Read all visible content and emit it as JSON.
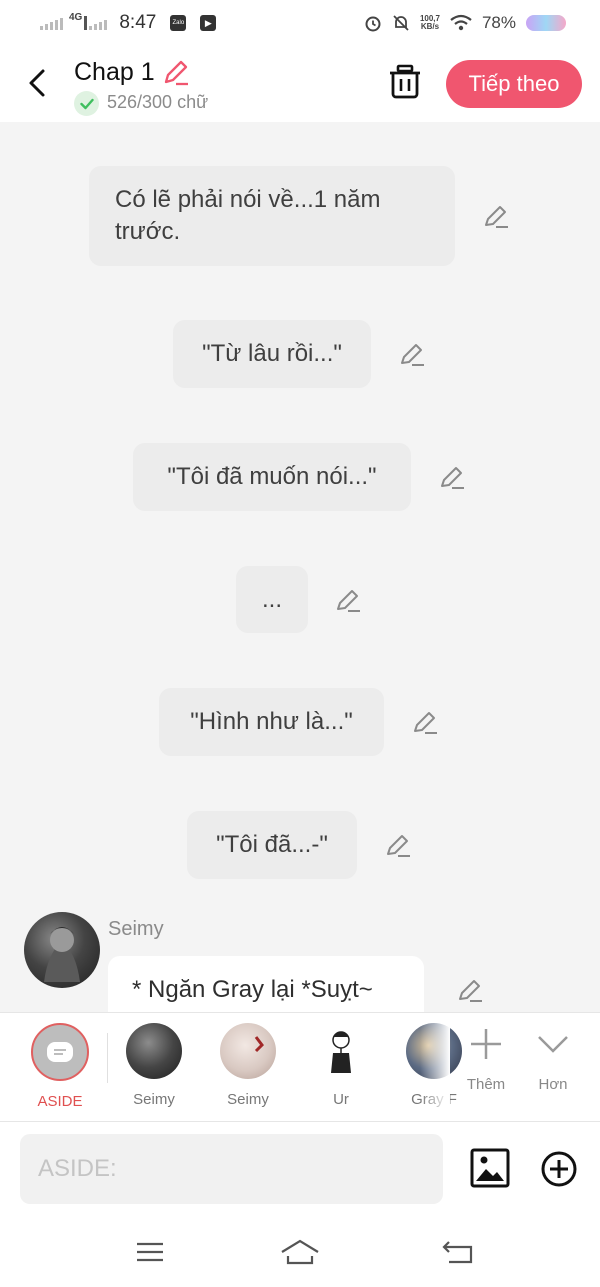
{
  "status_bar": {
    "network": "4G",
    "time": "8:47",
    "apps": [
      "Zalo",
      "▶"
    ],
    "speed_value": "100,7",
    "speed_unit": "KB/s",
    "battery_pct": "78%"
  },
  "header": {
    "title": "Chap 1",
    "word_count": "526/300 chữ",
    "next_label": "Tiếp theo"
  },
  "messages": [
    {
      "text": "Có lẽ phải nói về...1 năm trước."
    },
    {
      "text": "\"Từ lâu rồi...\""
    },
    {
      "text": "\"Tôi đã muốn nói...\""
    },
    {
      "text": "..."
    },
    {
      "text": "\"Hình như là...\""
    },
    {
      "text": "\"Tôi đã...-\""
    }
  ],
  "character_message": {
    "speaker": "Seimy",
    "text": "* Ngăn Gray lại *Suỵt~"
  },
  "characters": [
    {
      "name": "ASIDE",
      "selected": true
    },
    {
      "name": "Seimy"
    },
    {
      "name": "Seimy"
    },
    {
      "name": "Ur"
    },
    {
      "name": "Gray F"
    }
  ],
  "tools": {
    "add_label": "Thêm",
    "more_label": "Hơn"
  },
  "input": {
    "placeholder": "ASIDE:"
  },
  "colors": {
    "accent": "#f0566f",
    "bubble": "#ececec",
    "check_green": "#3fbf5f"
  }
}
